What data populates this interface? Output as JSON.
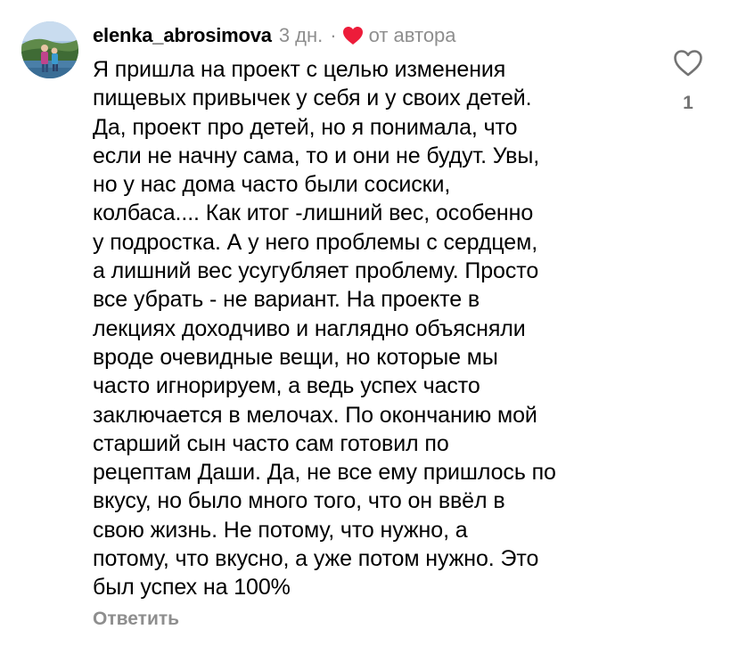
{
  "comment": {
    "username": "elenka_abrosimova",
    "time": "3 дн.",
    "separator": "·",
    "author_badge": "от автора",
    "text": "Я пришла на проект с целью изменения\nпищевых привычек у себя и у своих детей.\nДа, проект про детей, но я понимала, что\nесли не начну сама, то и они не будут. Увы,\nно у нас дома часто были сосиски,\nколбаса.... Как итог -лишний вес, особенно\nу подростка. А у него проблемы с сердцем,\nа лишний вес усугубляет проблему. Просто\nвсе убрать - не вариант. На проекте в\nлекциях доходчиво и наглядно объясняли\nвроде очевидные вещи, но которые мы\nчасто игнорируем, а ведь успех часто\nзаключается в мелочах. По окончанию мой\nстарший сын часто сам готовил по\nрецептам Даши. Да, не все ему пришлось по\nвкусу, но было много того, что он ввёл в\nсвою жизнь. Не потому, что нужно, а\nпотому, что вкусно, а уже потом нужно. Это\nбыл успех на 100%",
    "reply_label": "Ответить",
    "like_count": "1"
  },
  "icons": {
    "author_heart": "heart-filled-icon",
    "like": "heart-outline-icon"
  },
  "colors": {
    "author_heart": "#ed1c3a",
    "secondary_text": "#8e8e8e",
    "like_icon": "#737373"
  }
}
